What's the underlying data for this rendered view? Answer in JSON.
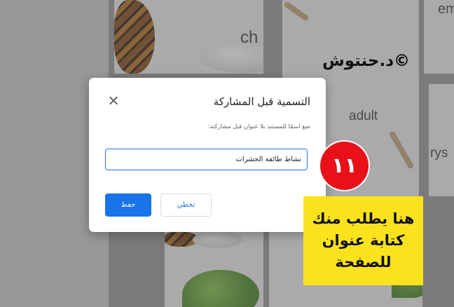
{
  "background": {
    "labels": [
      "ch",
      "adult",
      "em",
      "rys"
    ]
  },
  "watermark": "©د.حنتوش",
  "dialog": {
    "title": "التسمية قبل المشاركة",
    "description": "ضع اسمًا للمستند بلا عنوان قبل مشاركته:",
    "input_value": "نشاط طائفة الحشرات",
    "skip_label": "تخطي",
    "save_label": "حفظ",
    "close_icon": "close-icon"
  },
  "annotation": {
    "step_number": "١١",
    "note": "هنا يطلب منك\nكتابة عنوان\nللصفحة"
  },
  "colors": {
    "accent": "#1a73e8",
    "badge": "#e8111a",
    "note_bg": "#fae21d"
  }
}
